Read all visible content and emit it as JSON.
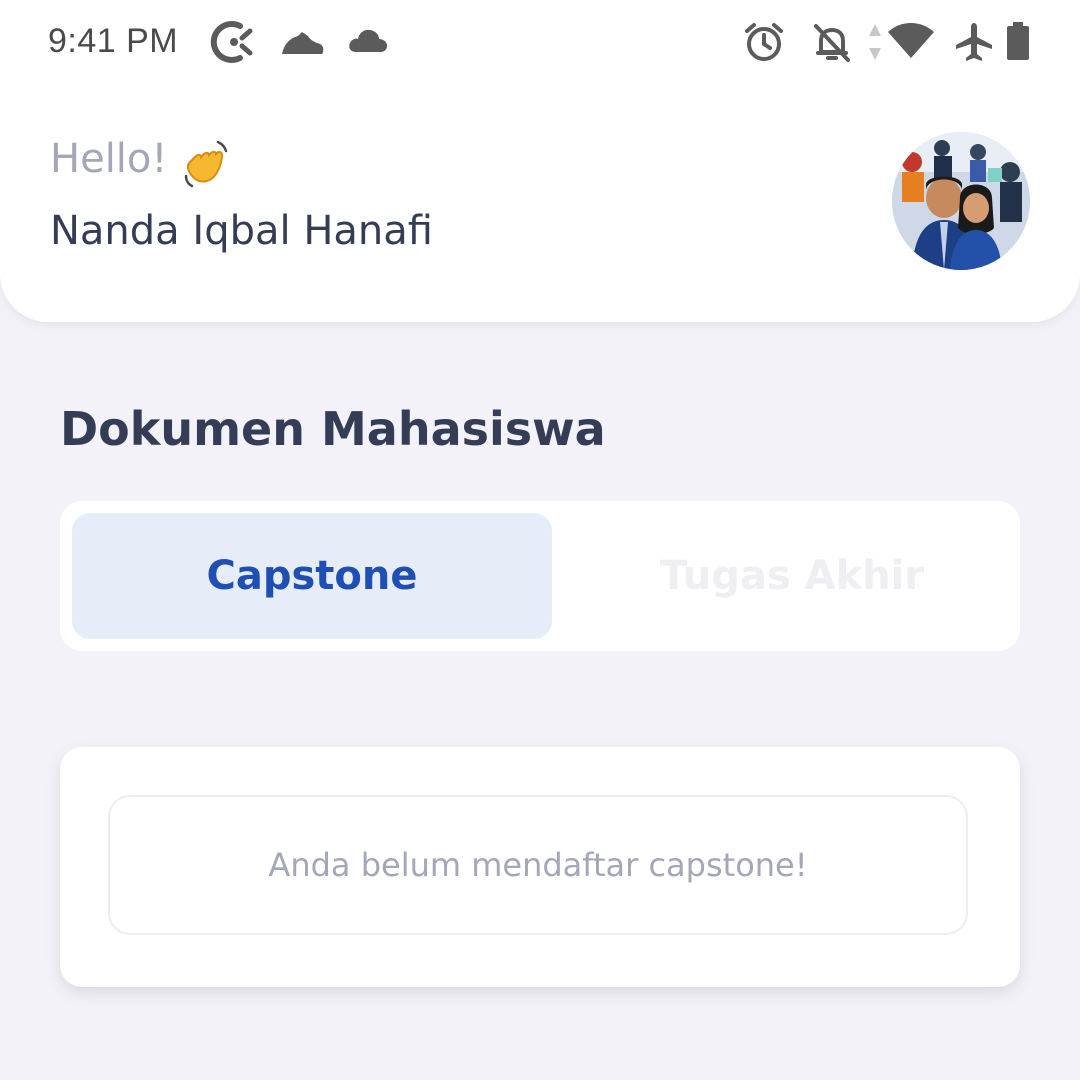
{
  "status_bar": {
    "time": "9:41 PM",
    "icons": [
      "clockify-icon",
      "shoe-icon",
      "cloud-icon",
      "alarm-icon",
      "bell-off-icon",
      "data-arrows-icon",
      "wifi-icon",
      "airplane-icon",
      "battery-icon"
    ]
  },
  "header": {
    "greeting": "Hello!",
    "wave_emoji": "👋",
    "user_name": "Nanda Iqbal Hanafi",
    "avatar": "profile-photo"
  },
  "section": {
    "title": "Dokumen Mahasiswa"
  },
  "tabs": [
    {
      "label": "Capstone",
      "active": true
    },
    {
      "label": "Tugas Akhir",
      "active": false
    }
  ],
  "empty_state": {
    "message": "Anda belum mendaftar capstone!"
  },
  "colors": {
    "background": "#f2f2f8",
    "card": "#ffffff",
    "primary": "#1f4fb3",
    "active_tab_bg": "#e6edf8",
    "heading": "#343d55",
    "muted": "#a4a7b8"
  }
}
